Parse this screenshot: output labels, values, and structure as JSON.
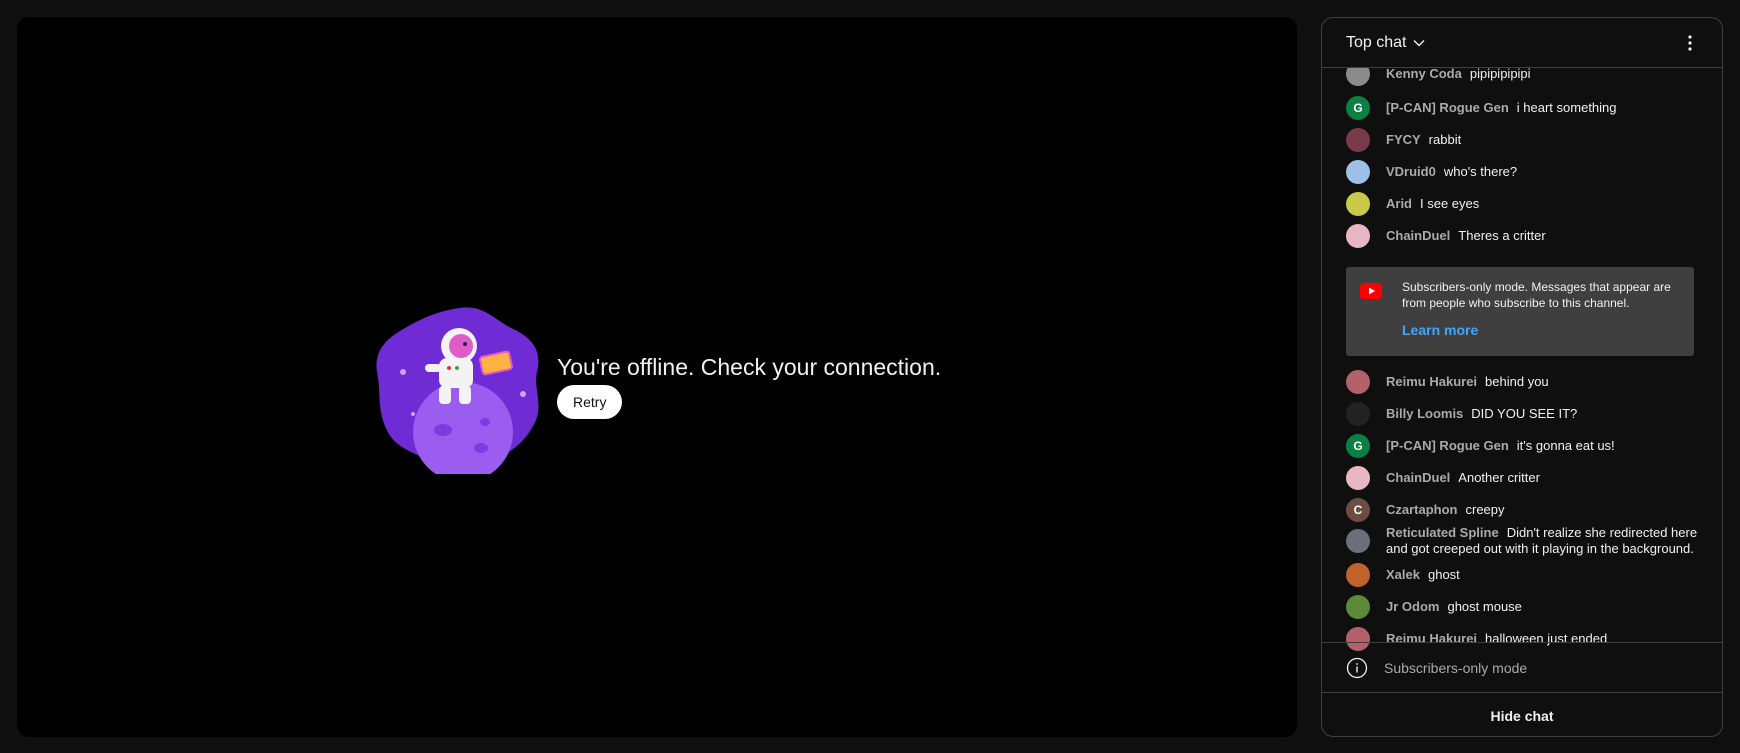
{
  "player": {
    "offline_message": "You're offline. Check your connection.",
    "retry_label": "Retry"
  },
  "chat": {
    "title": "Top chat",
    "messages": [
      {
        "author": "Kenny Coda",
        "text": "pipipipipipi",
        "avatar_letter": "",
        "avatar_color": "#8b8b8b"
      },
      {
        "author": "[P-CAN] Rogue Gen",
        "text": "i heart something",
        "avatar_letter": "G",
        "avatar_color": "#0b8043"
      },
      {
        "author": "FYCY",
        "text": "rabbit",
        "avatar_letter": "",
        "avatar_color": "#7a3a4a"
      },
      {
        "author": "VDruid0",
        "text": "who's there?",
        "avatar_letter": "",
        "avatar_color": "#9cc0e8"
      },
      {
        "author": "Arid",
        "text": "I see eyes",
        "avatar_letter": "",
        "avatar_color": "#c9c94a"
      },
      {
        "author": "ChainDuel",
        "text": "Theres a critter",
        "avatar_letter": "",
        "avatar_color": "#e9b7c4"
      },
      {
        "author": "Reimu Hakurei",
        "text": "behind you",
        "avatar_letter": "",
        "avatar_color": "#b5616a"
      },
      {
        "author": "Billy Loomis",
        "text": "DID YOU SEE IT?",
        "avatar_letter": "",
        "avatar_color": "#222222"
      },
      {
        "author": "[P-CAN] Rogue Gen",
        "text": "it's gonna eat us!",
        "avatar_letter": "G",
        "avatar_color": "#0b8043"
      },
      {
        "author": "ChainDuel",
        "text": "Another critter",
        "avatar_letter": "",
        "avatar_color": "#e9b7c4"
      },
      {
        "author": "Czartaphon",
        "text": "creepy",
        "avatar_letter": "C",
        "avatar_color": "#6d4c41"
      },
      {
        "author": "Reticulated Spline",
        "text": "Didn't realize she redirected here and got creeped out with it playing in the background.",
        "avatar_letter": "",
        "avatar_color": "#6a6f7a"
      },
      {
        "author": "Xalek",
        "text": "ghost",
        "avatar_letter": "",
        "avatar_color": "#c0632a"
      },
      {
        "author": "Jr Odom",
        "text": "ghost mouse",
        "avatar_letter": "",
        "avatar_color": "#5d8a3a"
      },
      {
        "author": "Reimu Hakurei",
        "text": "halloween just ended",
        "avatar_letter": "",
        "avatar_color": "#b5616a"
      }
    ],
    "banner": {
      "text": "Subscribers-only mode. Messages that appear are from people who subscribe to this channel.",
      "link": "Learn more"
    },
    "mode_label": "Subscribers-only mode",
    "hide_label": "Hide chat"
  },
  "colors": {
    "background": "#0f0f0f",
    "accent_link": "#3ea6ff",
    "youtube_red": "#ff0000"
  }
}
